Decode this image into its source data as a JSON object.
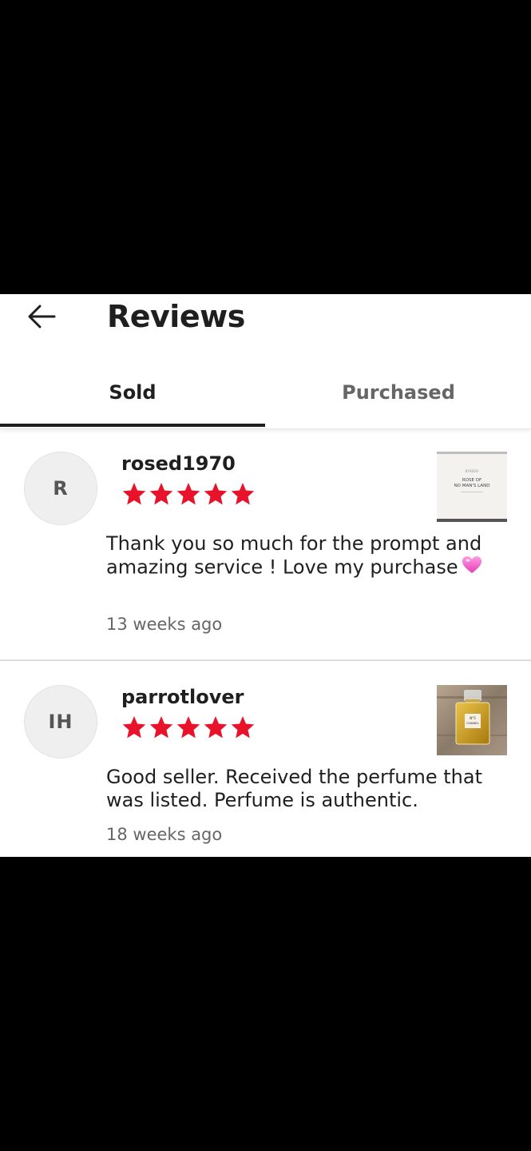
{
  "header": {
    "title": "Reviews"
  },
  "tabs": [
    {
      "label": "Sold",
      "active": true
    },
    {
      "label": "Purchased",
      "active": false
    }
  ],
  "reviews": [
    {
      "initials": "R",
      "username": "rosed1970",
      "rating": 5,
      "comment": "Thank you so much for the prompt and amazing service ! Love my purchase",
      "date": "13 weeks ago",
      "thumbnail": {
        "brand": "BYREDO",
        "line1": "ROSE OF",
        "line2": "NO MAN'S LAND"
      }
    },
    {
      "initials": "IH",
      "username": "parrotlover",
      "rating": 5,
      "comment": "Good seller. Received the perfume that was listed. Perfume is authentic.",
      "date": "18 weeks ago",
      "thumbnail": {
        "line1": "N°5",
        "line2": "CHANEL"
      }
    }
  ],
  "colors": {
    "star": "#e8132a",
    "text": "#1f1f1f",
    "muted": "#666666"
  }
}
